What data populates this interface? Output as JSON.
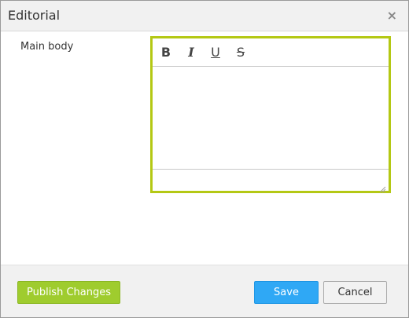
{
  "dialog": {
    "title": "Editorial",
    "close_glyph": "×",
    "close_icon": "close-icon"
  },
  "form": {
    "main_body_label": "Main body",
    "main_body_value": ""
  },
  "editor": {
    "accent_color": "#b4c814",
    "toolbar": {
      "bold": "B",
      "italic": "I",
      "underline": "U",
      "strikethrough": "S"
    },
    "resize_icon": "resize-grip-icon"
  },
  "footer": {
    "publish_label": "Publish Changes",
    "save_label": "Save",
    "cancel_label": "Cancel",
    "publish_color": "#9fcc2e",
    "save_color": "#2fa8f5"
  }
}
